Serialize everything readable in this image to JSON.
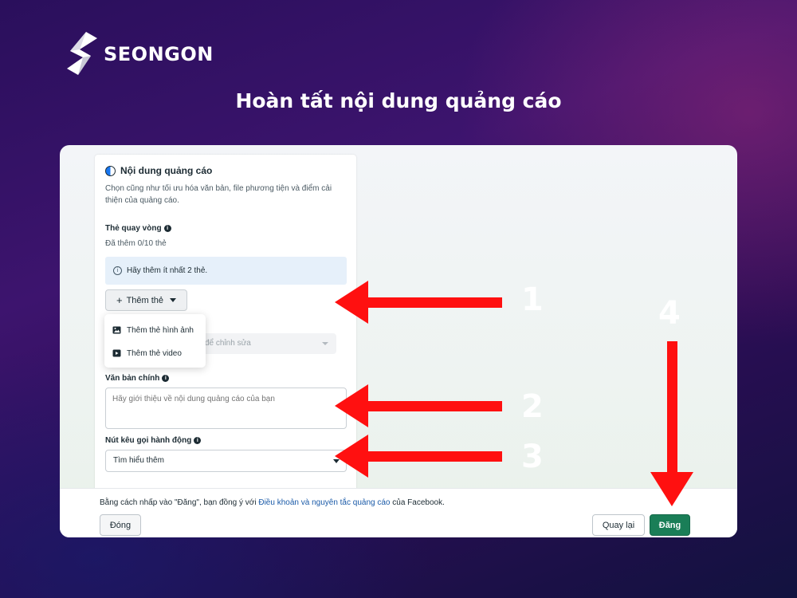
{
  "brand": {
    "name": "SEONGON"
  },
  "headline": "Hoàn tất nội dung quảng cáo",
  "panel": {
    "section_title": "Nội dung quảng cáo",
    "section_desc": "Chọn cũng như tối ưu hóa văn bản, file phương tiện và điểm cải thiện của quảng cáo.",
    "carousel_label": "Thẻ quay vòng",
    "carousel_count": "Đã thêm 0/10 thẻ",
    "notice": "Hãy thêm ít nhất 2 thẻ.",
    "add_card_label": "Thêm thẻ",
    "dropdown": {
      "image_option": "Thêm thẻ hình ảnh",
      "video_option": "Thêm thẻ video"
    },
    "disabled_select_text": "để chỉnh sửa",
    "primary_text_label": "Văn bản chính",
    "primary_text_placeholder": "Hãy giới thiệu về nội dung quảng cáo của bạn",
    "cta_label": "Nút kêu gọi hành động",
    "cta_value": "Tìm hiểu thêm"
  },
  "footer": {
    "terms_prefix": "Bằng cách nhấp vào \"Đăng\", bạn đồng ý với ",
    "terms_link": "Điều khoản và nguyên tắc quảng cáo",
    "terms_suffix": " của Facebook.",
    "close_label": "Đóng",
    "back_label": "Quay lại",
    "publish_label": "Đăng"
  },
  "annotations": {
    "step1": "1",
    "step2": "2",
    "step3": "3",
    "step4": "4",
    "arrow_color": "#ff1010"
  },
  "colors": {
    "publish": "#1a7e57",
    "link": "#1a5aa8",
    "notice_bg": "#e6f0fa"
  }
}
